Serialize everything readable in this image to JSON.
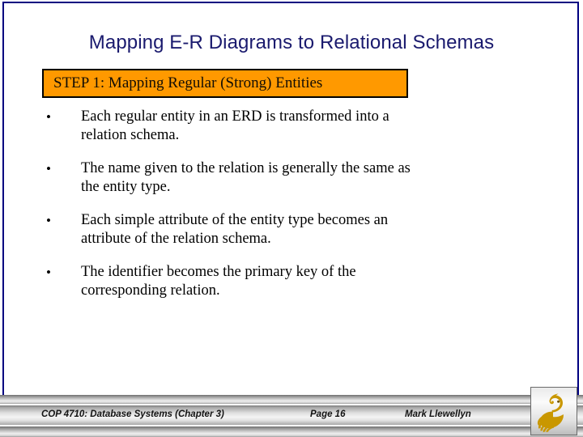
{
  "slide": {
    "title": "Mapping E-R Diagrams to Relational Schemas",
    "step_banner": "STEP 1:  Mapping Regular (Strong) Entities",
    "bullet_marker": "•",
    "bullets": [
      {
        "body": "Each regular entity in an ERD is transformed into a",
        "tail": "relation schema."
      },
      {
        "body": "The name given to the relation is generally the same as",
        "tail": "the entity type."
      },
      {
        "body": "Each simple attribute of the entity type becomes an",
        "tail": "attribute of the relation schema."
      },
      {
        "body": "The identifier becomes the primary key of the",
        "tail": "corresponding relation."
      }
    ]
  },
  "footer": {
    "course": "COP 4710: Database Systems  (Chapter 3)",
    "page": "Page 16",
    "author": "Mark Llewellyn"
  },
  "colors": {
    "frame": "#000080",
    "title_text": "#1a1a6e",
    "banner_fill": "#FF9900",
    "banner_border": "#000000",
    "body_text": "#000000",
    "logo_gold": "#C99700"
  }
}
